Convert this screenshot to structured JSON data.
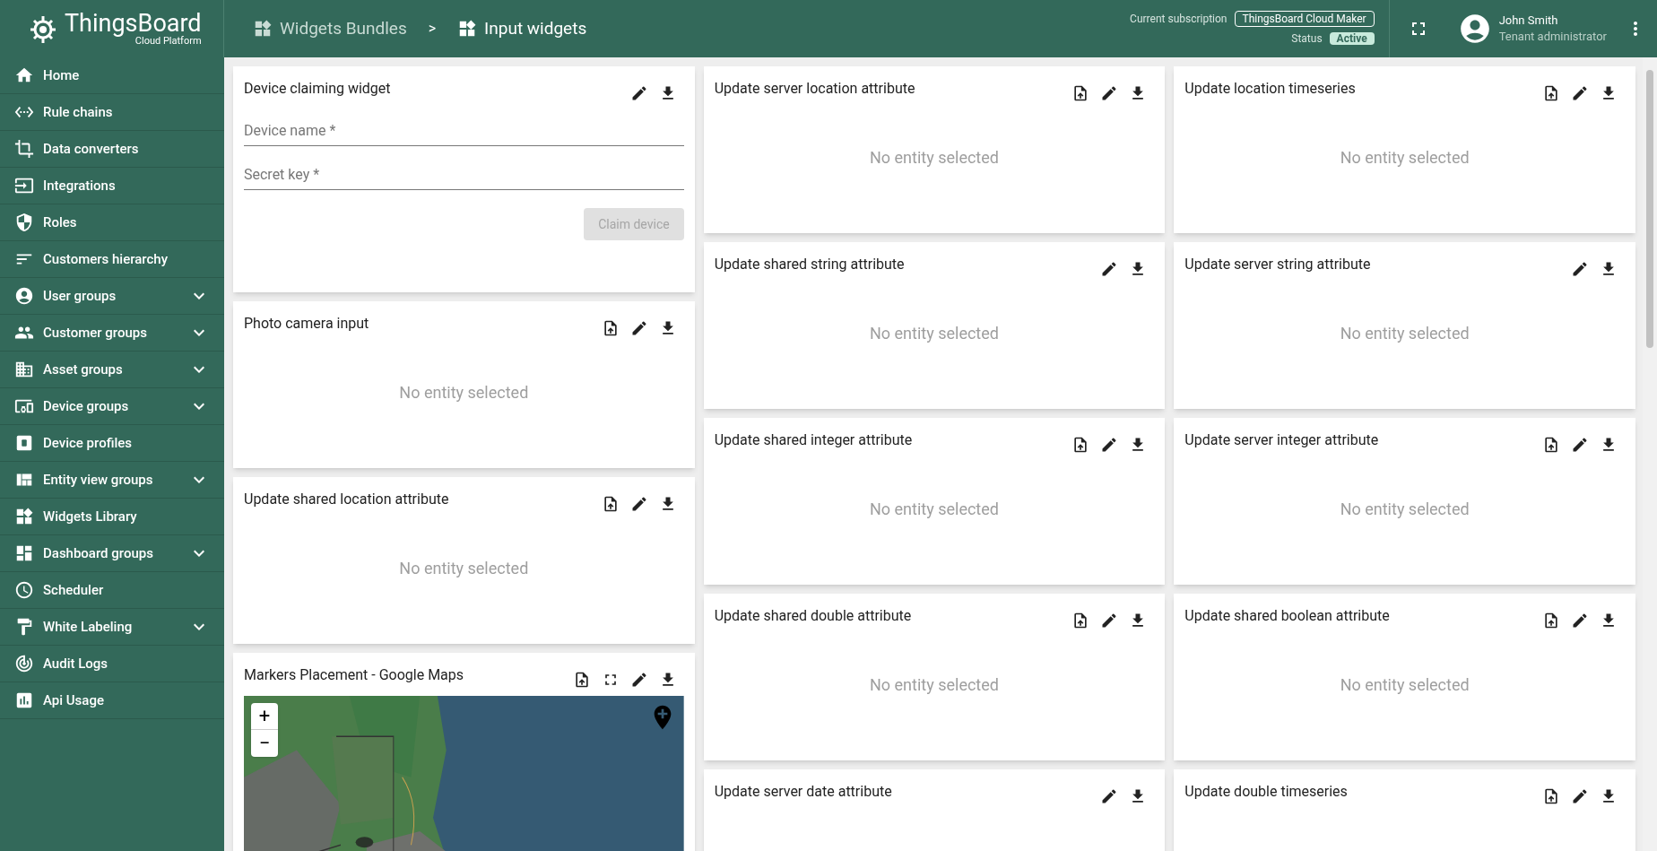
{
  "header": {
    "logo": {
      "title": "ThingsBoard",
      "subtitle": "Cloud Platform"
    },
    "breadcrumbs": [
      {
        "label": "Widgets Bundles",
        "selected": false
      },
      {
        "label": "Input widgets",
        "selected": true
      }
    ],
    "separator": ">",
    "subscription_label": "Current subscription",
    "subscription_value": "ThingsBoard Cloud Maker",
    "status_label": "Status",
    "status_value": "Active",
    "user": {
      "name": "John Smith",
      "role": "Tenant administrator"
    }
  },
  "sidebar": {
    "items": [
      {
        "label": "Home",
        "expandable": false
      },
      {
        "label": "Rule chains",
        "expandable": false
      },
      {
        "label": "Data converters",
        "expandable": false
      },
      {
        "label": "Integrations",
        "expandable": false
      },
      {
        "label": "Roles",
        "expandable": false
      },
      {
        "label": "Customers hierarchy",
        "expandable": false
      },
      {
        "label": "User groups",
        "expandable": true
      },
      {
        "label": "Customer groups",
        "expandable": true
      },
      {
        "label": "Asset groups",
        "expandable": true
      },
      {
        "label": "Device groups",
        "expandable": true
      },
      {
        "label": "Device profiles",
        "expandable": false
      },
      {
        "label": "Entity view groups",
        "expandable": true
      },
      {
        "label": "Widgets Library",
        "expandable": false
      },
      {
        "label": "Dashboard groups",
        "expandable": true
      },
      {
        "label": "Scheduler",
        "expandable": false
      },
      {
        "label": "White Labeling",
        "expandable": true
      },
      {
        "label": "Audit Logs",
        "expandable": false
      },
      {
        "label": "Api Usage",
        "expandable": false
      }
    ]
  },
  "columns": [
    [
      {
        "kind": "claim",
        "title": "Device claiming widget",
        "actions": [
          {
            "kind": "edit"
          },
          {
            "kind": "download"
          }
        ],
        "fields": [
          {
            "placeholder": "Device name *"
          },
          {
            "placeholder": "Secret key *"
          }
        ],
        "button": {
          "label": "Claim device",
          "disabled": true
        }
      },
      {
        "kind": "empty",
        "title": "Photo camera input",
        "actions": [
          {
            "kind": "export"
          },
          {
            "kind": "edit"
          },
          {
            "kind": "download"
          }
        ],
        "message": "No entity selected"
      },
      {
        "kind": "empty",
        "title": "Update shared location attribute",
        "actions": [
          {
            "kind": "export"
          },
          {
            "kind": "edit"
          },
          {
            "kind": "download"
          }
        ],
        "message": "No entity selected"
      },
      {
        "kind": "map",
        "title": "Markers Placement - Google Maps",
        "actions": [
          {
            "kind": "export"
          },
          {
            "kind": "fullscreen"
          },
          {
            "kind": "edit"
          },
          {
            "kind": "download"
          }
        ],
        "zoom_in": "+",
        "zoom_out": "−"
      }
    ],
    [
      {
        "kind": "empty",
        "title": "Update server location attribute",
        "actions": [
          {
            "kind": "export"
          },
          {
            "kind": "edit"
          },
          {
            "kind": "download"
          }
        ],
        "message": "No entity selected"
      },
      {
        "kind": "empty",
        "title": "Update shared string attribute",
        "actions": [
          {
            "kind": "edit"
          },
          {
            "kind": "download"
          }
        ],
        "message": "No entity selected"
      },
      {
        "kind": "empty",
        "title": "Update shared integer attribute",
        "actions": [
          {
            "kind": "export"
          },
          {
            "kind": "edit"
          },
          {
            "kind": "download"
          }
        ],
        "message": "No entity selected"
      },
      {
        "kind": "empty",
        "title": "Update shared double attribute",
        "actions": [
          {
            "kind": "export"
          },
          {
            "kind": "edit"
          },
          {
            "kind": "download"
          }
        ],
        "message": "No entity selected"
      },
      {
        "kind": "empty",
        "title": "Update server date attribute",
        "actions": [
          {
            "kind": "edit"
          },
          {
            "kind": "download"
          }
        ]
      }
    ],
    [
      {
        "kind": "empty",
        "title": "Update location timeseries",
        "actions": [
          {
            "kind": "export"
          },
          {
            "kind": "edit"
          },
          {
            "kind": "download"
          }
        ],
        "message": "No entity selected"
      },
      {
        "kind": "empty",
        "title": "Update server string attribute",
        "actions": [
          {
            "kind": "edit"
          },
          {
            "kind": "download"
          }
        ],
        "message": "No entity selected"
      },
      {
        "kind": "empty",
        "title": "Update server integer attribute",
        "actions": [
          {
            "kind": "export"
          },
          {
            "kind": "edit"
          },
          {
            "kind": "download"
          }
        ],
        "message": "No entity selected"
      },
      {
        "kind": "empty",
        "title": "Update shared boolean attribute",
        "actions": [
          {
            "kind": "export"
          },
          {
            "kind": "edit"
          },
          {
            "kind": "download"
          }
        ],
        "message": "No entity selected"
      },
      {
        "kind": "empty",
        "title": "Update double timeseries",
        "actions": [
          {
            "kind": "export"
          },
          {
            "kind": "edit"
          },
          {
            "kind": "download"
          }
        ]
      }
    ]
  ]
}
